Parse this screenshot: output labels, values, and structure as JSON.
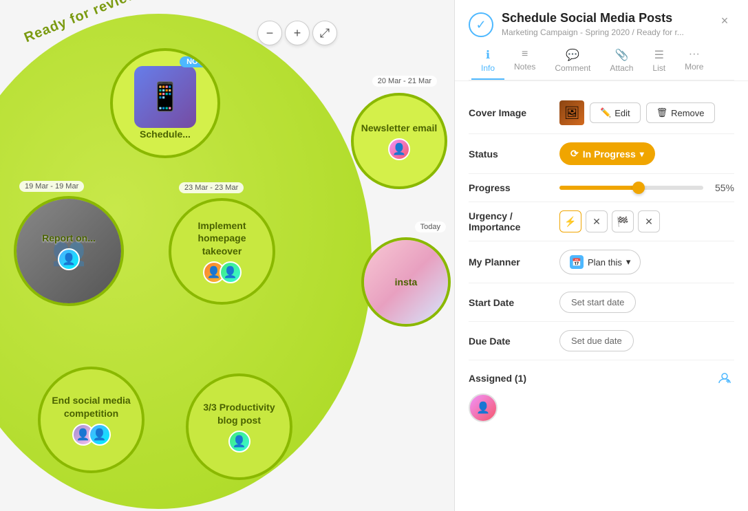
{
  "mindmap": {
    "title": "Ready for review",
    "zoom_minus": "−",
    "zoom_plus": "+",
    "zoom_fullscreen": "⤢",
    "tasks": [
      {
        "id": "schedule",
        "label": "Schedule...",
        "date": "",
        "has_phone": true,
        "has_now": true,
        "type": "main"
      },
      {
        "id": "newsletter",
        "label": "Newsletter email",
        "date": "20 Mar - 21 Mar",
        "type": "newsletter"
      },
      {
        "id": "report",
        "label": "Report on...",
        "date": "19 Mar - 19 Mar",
        "type": "report"
      },
      {
        "id": "implement",
        "label": "Implement homepage takeover",
        "date": "23 Mar - 23 Mar",
        "type": "implement"
      },
      {
        "id": "insta",
        "label": "Ins...",
        "date": "Today",
        "type": "insta"
      },
      {
        "id": "end-social",
        "label": "End social media competition",
        "date": "",
        "type": "end-social"
      },
      {
        "id": "productivity",
        "label": "3/3 Productivity blog post",
        "date": "",
        "type": "productivity"
      }
    ]
  },
  "panel": {
    "title": "Schedule Social Media Posts",
    "subtitle": "Marketing Campaign - Spring 2020 / Ready for r...",
    "close_label": "×",
    "tabs": [
      {
        "id": "info",
        "icon": "ℹ",
        "label": "Info",
        "active": true
      },
      {
        "id": "notes",
        "icon": "≡",
        "label": "Notes",
        "active": false
      },
      {
        "id": "comment",
        "icon": "💬",
        "label": "Comment",
        "active": false
      },
      {
        "id": "attach",
        "icon": "📎",
        "label": "Attach",
        "active": false
      },
      {
        "id": "list",
        "icon": "☰",
        "label": "List",
        "active": false
      },
      {
        "id": "more",
        "icon": "•••",
        "label": "More",
        "active": false
      }
    ],
    "fields": {
      "cover_image_label": "Cover Image",
      "cover_edit_label": "Edit",
      "cover_remove_label": "Remove",
      "status_label": "Status",
      "status_value": "In Progress",
      "progress_label": "Progress",
      "progress_value": 55,
      "progress_text": "55%",
      "urgency_label": "Urgency /",
      "importance_label": "Importance",
      "my_planner_label": "My Planner",
      "plan_this_label": "Plan this",
      "start_date_label": "Start Date",
      "start_date_placeholder": "Set start date",
      "due_date_label": "Due Date",
      "due_date_placeholder": "Set due date",
      "assigned_label": "Assigned (1)"
    }
  }
}
